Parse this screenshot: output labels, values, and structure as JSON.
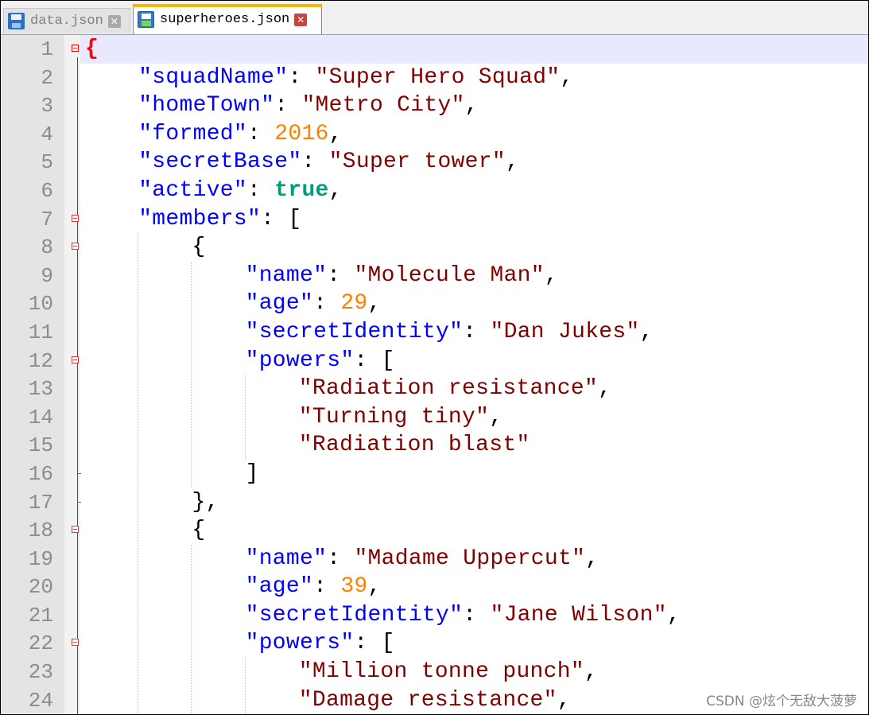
{
  "tabs": [
    {
      "label": "data.json",
      "active": false
    },
    {
      "label": "superheroes.json",
      "active": true
    }
  ],
  "icons": {
    "save": "save-icon",
    "close": "close-icon",
    "fold": "fold-minus-icon"
  },
  "colors": {
    "key": "#0000ff",
    "string": "#800000",
    "number": "#ff8000",
    "boolean": "#009d7a",
    "current_line": "#e8e8ff",
    "fold_line": "#ff0000"
  },
  "lines": [
    {
      "n": "1",
      "indent": 0,
      "fold": "open",
      "tokens": [
        {
          "t": "{",
          "c": "brace-hl"
        }
      ]
    },
    {
      "n": "2",
      "indent": 1,
      "tokens": [
        {
          "t": "\"squadName\"",
          "c": "k"
        },
        {
          "t": ": ",
          "c": "p"
        },
        {
          "t": "\"Super Hero Squad\"",
          "c": "s"
        },
        {
          "t": ",",
          "c": "p"
        }
      ]
    },
    {
      "n": "3",
      "indent": 1,
      "tokens": [
        {
          "t": "\"homeTown\"",
          "c": "k"
        },
        {
          "t": ": ",
          "c": "p"
        },
        {
          "t": "\"Metro City\"",
          "c": "s"
        },
        {
          "t": ",",
          "c": "p"
        }
      ]
    },
    {
      "n": "4",
      "indent": 1,
      "tokens": [
        {
          "t": "\"formed\"",
          "c": "k"
        },
        {
          "t": ": ",
          "c": "p"
        },
        {
          "t": "2016",
          "c": "n"
        },
        {
          "t": ",",
          "c": "p"
        }
      ]
    },
    {
      "n": "5",
      "indent": 1,
      "tokens": [
        {
          "t": "\"secretBase\"",
          "c": "k"
        },
        {
          "t": ": ",
          "c": "p"
        },
        {
          "t": "\"Super tower\"",
          "c": "s"
        },
        {
          "t": ",",
          "c": "p"
        }
      ]
    },
    {
      "n": "6",
      "indent": 1,
      "tokens": [
        {
          "t": "\"active\"",
          "c": "k"
        },
        {
          "t": ": ",
          "c": "p"
        },
        {
          "t": "true",
          "c": "b"
        },
        {
          "t": ",",
          "c": "p"
        }
      ]
    },
    {
      "n": "7",
      "indent": 1,
      "fold": "open",
      "tokens": [
        {
          "t": "\"members\"",
          "c": "k"
        },
        {
          "t": ": [",
          "c": "p"
        }
      ]
    },
    {
      "n": "8",
      "indent": 2,
      "fold": "open",
      "tokens": [
        {
          "t": "{",
          "c": "p"
        }
      ]
    },
    {
      "n": "9",
      "indent": 3,
      "tokens": [
        {
          "t": "\"name\"",
          "c": "k"
        },
        {
          "t": ": ",
          "c": "p"
        },
        {
          "t": "\"Molecule Man\"",
          "c": "s"
        },
        {
          "t": ",",
          "c": "p"
        }
      ]
    },
    {
      "n": "10",
      "indent": 3,
      "tokens": [
        {
          "t": "\"age\"",
          "c": "k"
        },
        {
          "t": ": ",
          "c": "p"
        },
        {
          "t": "29",
          "c": "n"
        },
        {
          "t": ",",
          "c": "p"
        }
      ]
    },
    {
      "n": "11",
      "indent": 3,
      "tokens": [
        {
          "t": "\"secretIdentity\"",
          "c": "k"
        },
        {
          "t": ": ",
          "c": "p"
        },
        {
          "t": "\"Dan Jukes\"",
          "c": "s"
        },
        {
          "t": ",",
          "c": "p"
        }
      ]
    },
    {
      "n": "12",
      "indent": 3,
      "fold": "open",
      "tokens": [
        {
          "t": "\"powers\"",
          "c": "k"
        },
        {
          "t": ": [",
          "c": "p"
        }
      ]
    },
    {
      "n": "13",
      "indent": 4,
      "tokens": [
        {
          "t": "\"Radiation resistance\"",
          "c": "s"
        },
        {
          "t": ",",
          "c": "p"
        }
      ]
    },
    {
      "n": "14",
      "indent": 4,
      "tokens": [
        {
          "t": "\"Turning tiny\"",
          "c": "s"
        },
        {
          "t": ",",
          "c": "p"
        }
      ]
    },
    {
      "n": "15",
      "indent": 4,
      "tokens": [
        {
          "t": "\"Radiation blast\"",
          "c": "s"
        }
      ]
    },
    {
      "n": "16",
      "indent": 3,
      "fold": "end",
      "tokens": [
        {
          "t": "]",
          "c": "p"
        }
      ]
    },
    {
      "n": "17",
      "indent": 2,
      "fold": "end",
      "tokens": [
        {
          "t": "},",
          "c": "p"
        }
      ]
    },
    {
      "n": "18",
      "indent": 2,
      "fold": "open",
      "tokens": [
        {
          "t": "{",
          "c": "p"
        }
      ]
    },
    {
      "n": "19",
      "indent": 3,
      "tokens": [
        {
          "t": "\"name\"",
          "c": "k"
        },
        {
          "t": ": ",
          "c": "p"
        },
        {
          "t": "\"Madame Uppercut\"",
          "c": "s"
        },
        {
          "t": ",",
          "c": "p"
        }
      ]
    },
    {
      "n": "20",
      "indent": 3,
      "tokens": [
        {
          "t": "\"age\"",
          "c": "k"
        },
        {
          "t": ": ",
          "c": "p"
        },
        {
          "t": "39",
          "c": "n"
        },
        {
          "t": ",",
          "c": "p"
        }
      ]
    },
    {
      "n": "21",
      "indent": 3,
      "tokens": [
        {
          "t": "\"secretIdentity\"",
          "c": "k"
        },
        {
          "t": ": ",
          "c": "p"
        },
        {
          "t": "\"Jane Wilson\"",
          "c": "s"
        },
        {
          "t": ",",
          "c": "p"
        }
      ]
    },
    {
      "n": "22",
      "indent": 3,
      "fold": "open",
      "tokens": [
        {
          "t": "\"powers\"",
          "c": "k"
        },
        {
          "t": ": [",
          "c": "p"
        }
      ]
    },
    {
      "n": "23",
      "indent": 4,
      "tokens": [
        {
          "t": "\"Million tonne punch\"",
          "c": "s"
        },
        {
          "t": ",",
          "c": "p"
        }
      ]
    },
    {
      "n": "24",
      "indent": 4,
      "tokens": [
        {
          "t": "\"Damage resistance\"",
          "c": "s"
        },
        {
          "t": ",",
          "c": "p"
        }
      ]
    }
  ],
  "watermark": "CSDN @炫个无敌大菠萝"
}
